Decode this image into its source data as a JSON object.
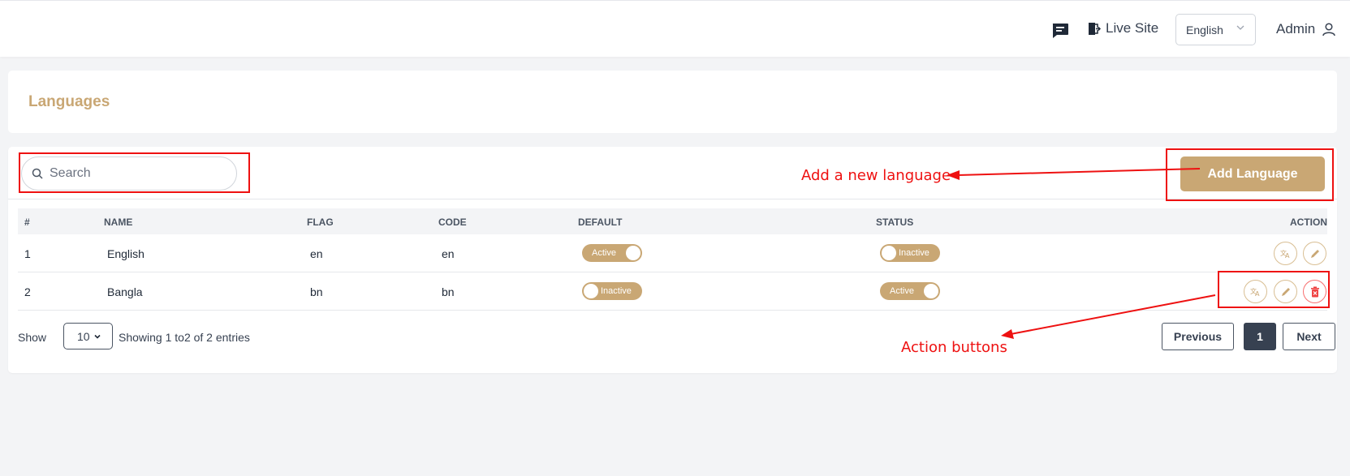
{
  "header": {
    "live_site_label": "Live Site",
    "language_selected": "English",
    "admin_label": "Admin"
  },
  "page": {
    "title": "Languages"
  },
  "search": {
    "placeholder": "Search"
  },
  "add_button_label": "Add Language",
  "table": {
    "columns": [
      "#",
      "NAME",
      "FLAG",
      "CODE",
      "DEFAULT",
      "STATUS",
      "ACTION"
    ],
    "rows": [
      {
        "index": "1",
        "name": "English",
        "flag": "en",
        "code": "en",
        "default": "Active",
        "status": "Inactive"
      },
      {
        "index": "2",
        "name": "Bangla",
        "flag": "bn",
        "code": "bn",
        "default": "Inactive",
        "status": "Active"
      }
    ]
  },
  "footer": {
    "show_label": "Show",
    "per_page": "10",
    "entries_text": "Showing 1  to2   of 2 entries",
    "previous_label": "Previous",
    "current_page": "1",
    "next_label": "Next"
  },
  "annotations": {
    "add_language_note": "Add a new language",
    "action_buttons_note": "Action buttons"
  },
  "colors": {
    "accent": "#c9a774",
    "annotation": "#ee1111"
  }
}
